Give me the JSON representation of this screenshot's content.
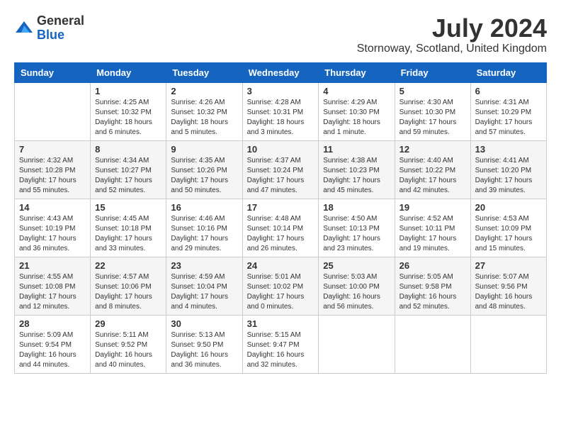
{
  "header": {
    "logo_general": "General",
    "logo_blue": "Blue",
    "month_year": "July 2024",
    "location": "Stornoway, Scotland, United Kingdom"
  },
  "days_of_week": [
    "Sunday",
    "Monday",
    "Tuesday",
    "Wednesday",
    "Thursday",
    "Friday",
    "Saturday"
  ],
  "weeks": [
    [
      {
        "day": "",
        "info": ""
      },
      {
        "day": "1",
        "info": "Sunrise: 4:25 AM\nSunset: 10:32 PM\nDaylight: 18 hours\nand 6 minutes."
      },
      {
        "day": "2",
        "info": "Sunrise: 4:26 AM\nSunset: 10:32 PM\nDaylight: 18 hours\nand 5 minutes."
      },
      {
        "day": "3",
        "info": "Sunrise: 4:28 AM\nSunset: 10:31 PM\nDaylight: 18 hours\nand 3 minutes."
      },
      {
        "day": "4",
        "info": "Sunrise: 4:29 AM\nSunset: 10:30 PM\nDaylight: 18 hours\nand 1 minute."
      },
      {
        "day": "5",
        "info": "Sunrise: 4:30 AM\nSunset: 10:30 PM\nDaylight: 17 hours\nand 59 minutes."
      },
      {
        "day": "6",
        "info": "Sunrise: 4:31 AM\nSunset: 10:29 PM\nDaylight: 17 hours\nand 57 minutes."
      }
    ],
    [
      {
        "day": "7",
        "info": "Sunrise: 4:32 AM\nSunset: 10:28 PM\nDaylight: 17 hours\nand 55 minutes."
      },
      {
        "day": "8",
        "info": "Sunrise: 4:34 AM\nSunset: 10:27 PM\nDaylight: 17 hours\nand 52 minutes."
      },
      {
        "day": "9",
        "info": "Sunrise: 4:35 AM\nSunset: 10:26 PM\nDaylight: 17 hours\nand 50 minutes."
      },
      {
        "day": "10",
        "info": "Sunrise: 4:37 AM\nSunset: 10:24 PM\nDaylight: 17 hours\nand 47 minutes."
      },
      {
        "day": "11",
        "info": "Sunrise: 4:38 AM\nSunset: 10:23 PM\nDaylight: 17 hours\nand 45 minutes."
      },
      {
        "day": "12",
        "info": "Sunrise: 4:40 AM\nSunset: 10:22 PM\nDaylight: 17 hours\nand 42 minutes."
      },
      {
        "day": "13",
        "info": "Sunrise: 4:41 AM\nSunset: 10:20 PM\nDaylight: 17 hours\nand 39 minutes."
      }
    ],
    [
      {
        "day": "14",
        "info": "Sunrise: 4:43 AM\nSunset: 10:19 PM\nDaylight: 17 hours\nand 36 minutes."
      },
      {
        "day": "15",
        "info": "Sunrise: 4:45 AM\nSunset: 10:18 PM\nDaylight: 17 hours\nand 33 minutes."
      },
      {
        "day": "16",
        "info": "Sunrise: 4:46 AM\nSunset: 10:16 PM\nDaylight: 17 hours\nand 29 minutes."
      },
      {
        "day": "17",
        "info": "Sunrise: 4:48 AM\nSunset: 10:14 PM\nDaylight: 17 hours\nand 26 minutes."
      },
      {
        "day": "18",
        "info": "Sunrise: 4:50 AM\nSunset: 10:13 PM\nDaylight: 17 hours\nand 23 minutes."
      },
      {
        "day": "19",
        "info": "Sunrise: 4:52 AM\nSunset: 10:11 PM\nDaylight: 17 hours\nand 19 minutes."
      },
      {
        "day": "20",
        "info": "Sunrise: 4:53 AM\nSunset: 10:09 PM\nDaylight: 17 hours\nand 15 minutes."
      }
    ],
    [
      {
        "day": "21",
        "info": "Sunrise: 4:55 AM\nSunset: 10:08 PM\nDaylight: 17 hours\nand 12 minutes."
      },
      {
        "day": "22",
        "info": "Sunrise: 4:57 AM\nSunset: 10:06 PM\nDaylight: 17 hours\nand 8 minutes."
      },
      {
        "day": "23",
        "info": "Sunrise: 4:59 AM\nSunset: 10:04 PM\nDaylight: 17 hours\nand 4 minutes."
      },
      {
        "day": "24",
        "info": "Sunrise: 5:01 AM\nSunset: 10:02 PM\nDaylight: 17 hours\nand 0 minutes."
      },
      {
        "day": "25",
        "info": "Sunrise: 5:03 AM\nSunset: 10:00 PM\nDaylight: 16 hours\nand 56 minutes."
      },
      {
        "day": "26",
        "info": "Sunrise: 5:05 AM\nSunset: 9:58 PM\nDaylight: 16 hours\nand 52 minutes."
      },
      {
        "day": "27",
        "info": "Sunrise: 5:07 AM\nSunset: 9:56 PM\nDaylight: 16 hours\nand 48 minutes."
      }
    ],
    [
      {
        "day": "28",
        "info": "Sunrise: 5:09 AM\nSunset: 9:54 PM\nDaylight: 16 hours\nand 44 minutes."
      },
      {
        "day": "29",
        "info": "Sunrise: 5:11 AM\nSunset: 9:52 PM\nDaylight: 16 hours\nand 40 minutes."
      },
      {
        "day": "30",
        "info": "Sunrise: 5:13 AM\nSunset: 9:50 PM\nDaylight: 16 hours\nand 36 minutes."
      },
      {
        "day": "31",
        "info": "Sunrise: 5:15 AM\nSunset: 9:47 PM\nDaylight: 16 hours\nand 32 minutes."
      },
      {
        "day": "",
        "info": ""
      },
      {
        "day": "",
        "info": ""
      },
      {
        "day": "",
        "info": ""
      }
    ]
  ]
}
